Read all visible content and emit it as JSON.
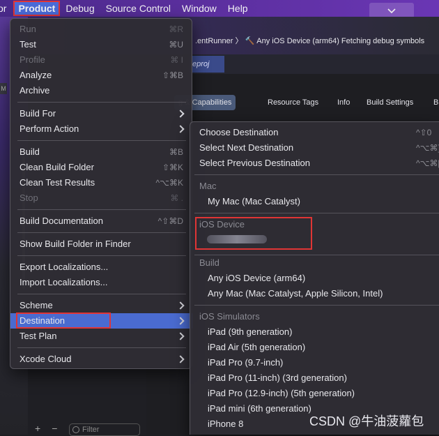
{
  "menubar": {
    "items": [
      "or",
      "Product",
      "Debug",
      "Source Control",
      "Window",
      "Help"
    ]
  },
  "toolbar": {
    "breadcrumb": ".entRunner 〉 🔨 Any iOS Device (arm64)    Fetching debug symbols",
    "project_tab": "eproj"
  },
  "editor_tabs": [
    "g & Capabilities",
    "Resource Tags",
    "Info",
    "Build Settings",
    "B"
  ],
  "left_strip_badge": "M",
  "navigator": {
    "filter_placeholder": "Filter",
    "add": "+",
    "remove": "−"
  },
  "product_menu": {
    "items": [
      {
        "label": "Run",
        "shortcut": "⌘R",
        "disabled": true
      },
      {
        "label": "Test",
        "shortcut": "⌘U"
      },
      {
        "label": "Profile",
        "shortcut": "⌘ I",
        "disabled": true
      },
      {
        "label": "Analyze",
        "shortcut": "⇧⌘B"
      },
      {
        "label": "Archive",
        "shortcut": ""
      },
      {
        "label": "Build For",
        "submenu": true
      },
      {
        "label": "Perform Action",
        "submenu": true
      },
      {
        "label": "Build",
        "shortcut": "⌘B"
      },
      {
        "label": "Clean Build Folder",
        "shortcut": "⇧⌘K"
      },
      {
        "label": "Clean Test Results",
        "shortcut": "^⌥⌘K"
      },
      {
        "label": "Stop",
        "shortcut": "⌘ .",
        "disabled": true
      },
      {
        "label": "Build Documentation",
        "shortcut": "^⇧⌘D"
      },
      {
        "label": "Show Build Folder in Finder",
        "shortcut": ""
      },
      {
        "label": "Export Localizations...",
        "shortcut": ""
      },
      {
        "label": "Import Localizations...",
        "shortcut": ""
      },
      {
        "label": "Scheme",
        "submenu": true
      },
      {
        "label": "Destination",
        "submenu": true,
        "highlighted": true
      },
      {
        "label": "Test Plan",
        "submenu": true
      },
      {
        "label": "Xcode Cloud",
        "submenu": true
      }
    ]
  },
  "destination_menu": {
    "actions": [
      {
        "label": "Choose Destination",
        "shortcut": "^⇧0"
      },
      {
        "label": "Select Next Destination",
        "shortcut": "^⌥⌘]"
      },
      {
        "label": "Select Previous Destination",
        "shortcut": "^⌥⌘["
      }
    ],
    "sections": {
      "mac": "Mac",
      "ios_device": "iOS Device",
      "build": "Build",
      "ios_simulators": "iOS Simulators"
    },
    "mac_items": [
      "My Mac (Mac Catalyst)"
    ],
    "build_items": [
      "Any iOS Device (arm64)",
      "Any Mac (Mac Catalyst, Apple Silicon, Intel)"
    ],
    "simulators": [
      "iPad (9th generation)",
      "iPad Air (5th generation)",
      "iPad Pro (9.7-inch)",
      "iPad Pro (11-inch) (3rd generation)",
      "iPad Pro (12.9-inch) (5th generation)",
      "iPad mini (6th generation)",
      "iPhone 8"
    ]
  },
  "watermark": "CSDN @牛油菠蘿包",
  "colors": {
    "highlight": "#4a6bd0",
    "annotation_red": "#e03535",
    "menubar": "#5b2f9e"
  }
}
